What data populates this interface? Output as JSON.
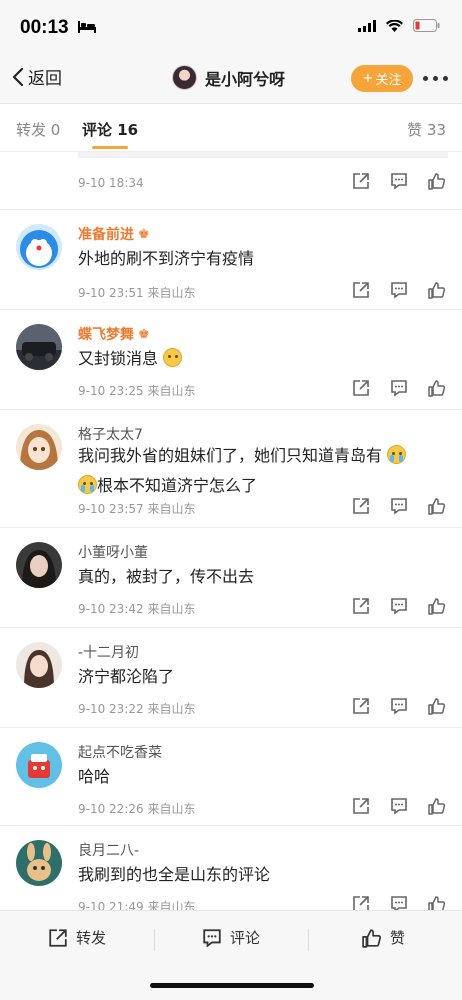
{
  "status": {
    "time": "00:13"
  },
  "nav": {
    "back_label": "返回",
    "user_name": "是小阿兮呀",
    "follow_label": "关注"
  },
  "tabs": [
    {
      "label": "转发",
      "count": "0"
    },
    {
      "label": "评论",
      "count": "16"
    },
    {
      "label": "赞",
      "count": "33"
    }
  ],
  "first_meta": {
    "time": "9-10 18:34"
  },
  "comments": [
    {
      "name": "准备前进",
      "vip": true,
      "text": "外地的刷不到济宁有疫情",
      "time": "9-10 23:51",
      "location": "来自山东"
    },
    {
      "name": "蝶飞梦舞",
      "vip": true,
      "text": "又封锁消息",
      "time": "9-10 23:25",
      "location": "来自山东"
    },
    {
      "name": "格子太太7",
      "vip": false,
      "text_line1": "我问我外省的姐妹们了，她们只知道青岛有",
      "text_line2": "根本不知道济宁怎么了",
      "time": "9-10 23:57",
      "location": "来自山东"
    },
    {
      "name": "小董呀小董",
      "vip": false,
      "text": "真的，被封了，传不出去",
      "time": "9-10 23:42",
      "location": "来自山东"
    },
    {
      "name": "-十二月初",
      "vip": false,
      "text": "济宁都沦陷了",
      "time": "9-10 23:22",
      "location": "来自山东"
    },
    {
      "name": "起点不吃香菜",
      "vip": false,
      "text": "哈哈",
      "time": "9-10 22:26",
      "location": "来自山东"
    },
    {
      "name": "良月二八-",
      "vip": false,
      "text": "我刷到的也全是山东的评论",
      "time": "9-10 21:49",
      "location": "来自山东"
    }
  ],
  "bottom": {
    "repost_label": "转发",
    "comment_label": "评论",
    "like_label": "赞"
  },
  "colors": {
    "accent": "#f7a53b",
    "vip_name": "#f07b2e"
  }
}
